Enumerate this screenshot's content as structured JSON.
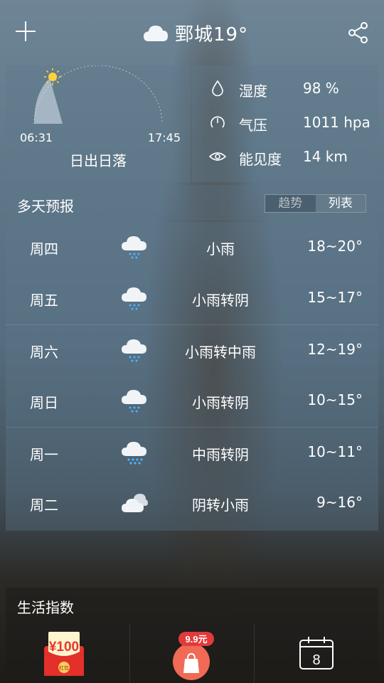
{
  "header": {
    "add_icon": "plus-icon",
    "weather_icon": "cloud-icon",
    "city_title": "鄄城19°",
    "share_icon": "share-icon"
  },
  "sun": {
    "sunrise": "06:31",
    "sunset": "17:45",
    "label": "日出日落"
  },
  "stats": [
    {
      "icon": "humidity-drop-icon",
      "label": "湿度",
      "value": "98 %"
    },
    {
      "icon": "pressure-gauge-icon",
      "label": "气压",
      "value": "1011 hpa"
    },
    {
      "icon": "visibility-eye-icon",
      "label": "能见度",
      "value": "14 km"
    }
  ],
  "forecast": {
    "title": "多天预报",
    "toggle": {
      "trend": "趋势",
      "list": "列表",
      "active": "list"
    },
    "days": [
      {
        "day": "周四",
        "icon": "light-rain-icon",
        "condition": "小雨",
        "temp": "18~20°"
      },
      {
        "day": "周五",
        "icon": "light-rain-icon",
        "condition": "小雨转阴",
        "temp": "15~17°"
      },
      {
        "day": "周六",
        "icon": "light-rain-icon",
        "condition": "小雨转中雨",
        "temp": "12~19°"
      },
      {
        "day": "周日",
        "icon": "light-rain-icon",
        "condition": "小雨转阴",
        "temp": "10~15°"
      },
      {
        "day": "周一",
        "icon": "moderate-rain-icon",
        "condition": "中雨转阴",
        "temp": "10~11°"
      },
      {
        "day": "周二",
        "icon": "overcast-icon",
        "condition": "阴转小雨",
        "temp": "9~16°"
      }
    ]
  },
  "life": {
    "title": "生活指数",
    "items": [
      {
        "icon": "red-packet-icon",
        "text": "¥100",
        "sub": "红包"
      },
      {
        "icon": "shopping-bag-icon",
        "badge": "9.9元"
      },
      {
        "icon": "calendar-icon",
        "text": "8"
      }
    ]
  },
  "colors": {
    "rain_drop": "#4fb4ff",
    "red_packet": "#e8372c",
    "red_packet_gold": "#f7d35b",
    "bag": "#f06a55",
    "badge": "#e23a3a"
  }
}
